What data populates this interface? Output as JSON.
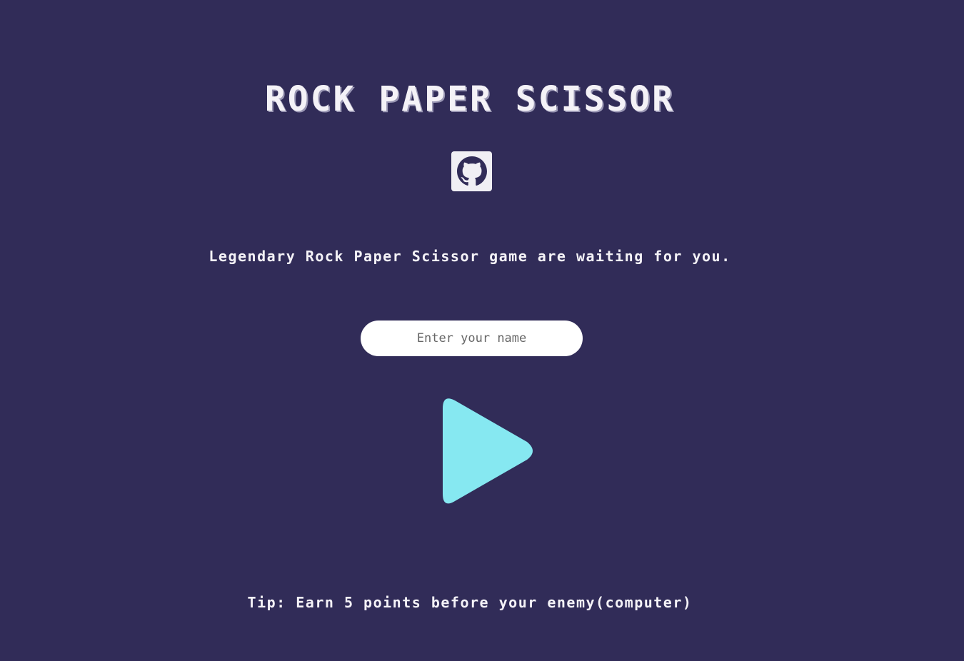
{
  "header": {
    "title": "ROCK PAPER SCISSOR"
  },
  "links": {
    "github_icon": "github-icon"
  },
  "intro": {
    "tagline": "Legendary Rock Paper Scissor game are waiting for you."
  },
  "form": {
    "name_placeholder": "Enter your name",
    "name_value": ""
  },
  "actions": {
    "play_icon": "play-icon"
  },
  "footer": {
    "tip": "Tip: Earn 5 points before your enemy(computer)"
  },
  "colors": {
    "background": "#312c58",
    "play": "#86e8f1",
    "github_bg": "#f0eff4"
  }
}
